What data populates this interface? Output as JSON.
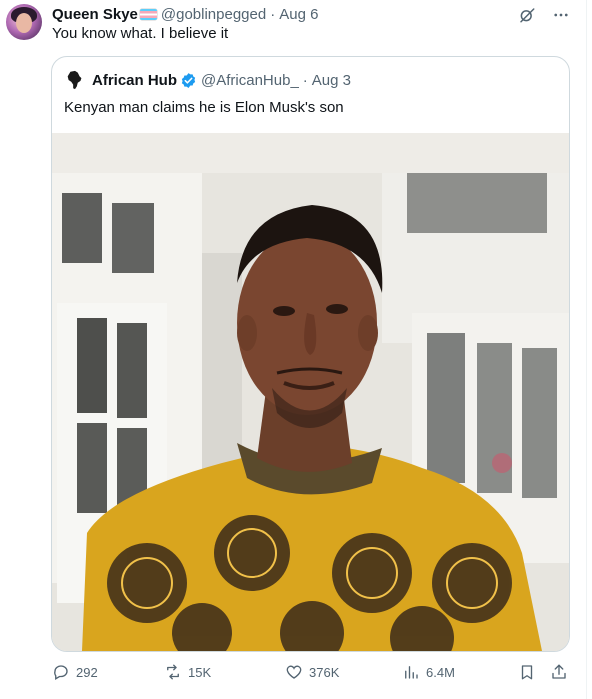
{
  "tweet": {
    "display_name": "Queen Skye",
    "handle": "@goblinpegged",
    "separator": "·",
    "date": "Aug 6",
    "text": "You know what. I believe it"
  },
  "quoted": {
    "display_name": "African Hub",
    "handle": "@AfricanHub_",
    "separator": "·",
    "date": "Aug 3",
    "text": "Kenyan man claims he is Elon Musk's son"
  },
  "metrics": {
    "replies": "292",
    "reposts": "15K",
    "likes": "376K",
    "views": "6.4M"
  },
  "icons": {
    "grok": "grok-icon",
    "more": "more-icon",
    "reply": "reply-icon",
    "repost": "repost-icon",
    "like": "heart-icon",
    "views": "views-icon",
    "bookmark": "bookmark-icon",
    "share": "share-icon",
    "verified": "verified-badge-icon"
  },
  "colors": {
    "text": "#0f1419",
    "muted": "#536471",
    "border": "#cfd9de",
    "verified": "#1d9bf0"
  }
}
